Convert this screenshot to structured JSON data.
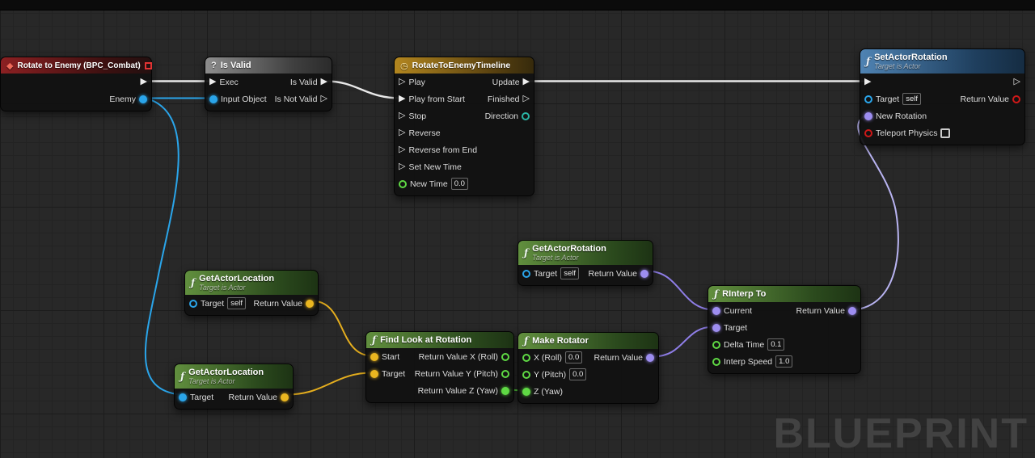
{
  "watermark": "BLUEPRINT",
  "icons": {
    "event": "◆",
    "macro": "?",
    "timeline": "◷",
    "function": "ƒ"
  },
  "glyphs": {
    "exec_filled": "▶",
    "exec_hollow": "▷"
  },
  "colors": {
    "exec": "#e9e9e9",
    "object": "#2aa5ea",
    "vector": "#eab620",
    "rotator": "#9d8df0",
    "float": "#5fd944",
    "enum": "#2ab5a5",
    "bool": "#cf1818"
  },
  "nodes": {
    "rotate_to_enemy": {
      "title": "Rotate to Enemy (BPC_Combat)",
      "pins": {
        "enemy": "Enemy"
      }
    },
    "is_valid": {
      "title": "Is Valid",
      "pins": {
        "exec": "Exec",
        "input_object": "Input Object",
        "is_valid": "Is Valid",
        "is_not_valid": "Is Not Valid"
      }
    },
    "timeline": {
      "title": "RotateToEnemyTimeline",
      "pins": {
        "play": "Play",
        "play_from_start": "Play from Start",
        "stop": "Stop",
        "reverse": "Reverse",
        "reverse_from_end": "Reverse from End",
        "set_new_time": "Set New Time",
        "new_time": "New Time",
        "new_time_value": "0.0",
        "update": "Update",
        "finished": "Finished",
        "direction": "Direction"
      }
    },
    "set_actor_rotation": {
      "title": "SetActorRotation",
      "subtitle": "Target is Actor",
      "pins": {
        "target": "Target",
        "target_value": "self",
        "new_rotation": "New Rotation",
        "teleport_physics": "Teleport Physics",
        "return_value": "Return Value"
      }
    },
    "get_actor_rotation": {
      "title": "GetActorRotation",
      "subtitle": "Target is Actor",
      "pins": {
        "target": "Target",
        "target_value": "self",
        "return_value": "Return Value"
      }
    },
    "get_actor_location_self": {
      "title": "GetActorLocation",
      "subtitle": "Target is Actor",
      "pins": {
        "target": "Target",
        "target_value": "self",
        "return_value": "Return Value"
      }
    },
    "get_actor_location_enemy": {
      "title": "GetActorLocation",
      "subtitle": "Target is Actor",
      "pins": {
        "target": "Target",
        "return_value": "Return Value"
      }
    },
    "find_look_at_rotation": {
      "title": "Find Look at Rotation",
      "pins": {
        "start": "Start",
        "target": "Target",
        "rv_x": "Return Value X (Roll)",
        "rv_y": "Return Value Y (Pitch)",
        "rv_z": "Return Value Z (Yaw)"
      }
    },
    "make_rotator": {
      "title": "Make Rotator",
      "pins": {
        "x_roll": "X (Roll)",
        "x_value": "0.0",
        "y_pitch": "Y (Pitch)",
        "y_value": "0.0",
        "z_yaw": "Z (Yaw)",
        "return_value": "Return Value"
      }
    },
    "rinterp_to": {
      "title": "RInterp To",
      "pins": {
        "current": "Current",
        "target": "Target",
        "delta_time": "Delta Time",
        "delta_time_value": "0.1",
        "interp_speed": "Interp Speed",
        "interp_speed_value": "1.0",
        "return_value": "Return Value"
      }
    }
  },
  "connections": [
    {
      "from": "rotate_to_enemy.exec",
      "to": "is_valid.exec",
      "type": "exec"
    },
    {
      "from": "rotate_to_enemy.enemy",
      "to": "is_valid.input_object",
      "type": "object"
    },
    {
      "from": "rotate_to_enemy.enemy",
      "to": "get_actor_location_enemy.target",
      "type": "object"
    },
    {
      "from": "is_valid.is_valid",
      "to": "timeline.play_from_start",
      "type": "exec"
    },
    {
      "from": "timeline.update",
      "to": "set_actor_rotation.exec_in",
      "type": "exec"
    },
    {
      "from": "get_actor_rotation.return_value",
      "to": "rinterp_to.current",
      "type": "rotator"
    },
    {
      "from": "make_rotator.return_value",
      "to": "rinterp_to.target",
      "type": "rotator"
    },
    {
      "from": "rinterp_to.return_value",
      "to": "set_actor_rotation.new_rotation",
      "type": "rotator"
    },
    {
      "from": "get_actor_location_self.return_value",
      "to": "find_look_at_rotation.start",
      "type": "vector"
    },
    {
      "from": "get_actor_location_enemy.return_value",
      "to": "find_look_at_rotation.target",
      "type": "vector"
    },
    {
      "from": "find_look_at_rotation.rv_z",
      "to": "make_rotator.z_yaw",
      "type": "float"
    }
  ]
}
